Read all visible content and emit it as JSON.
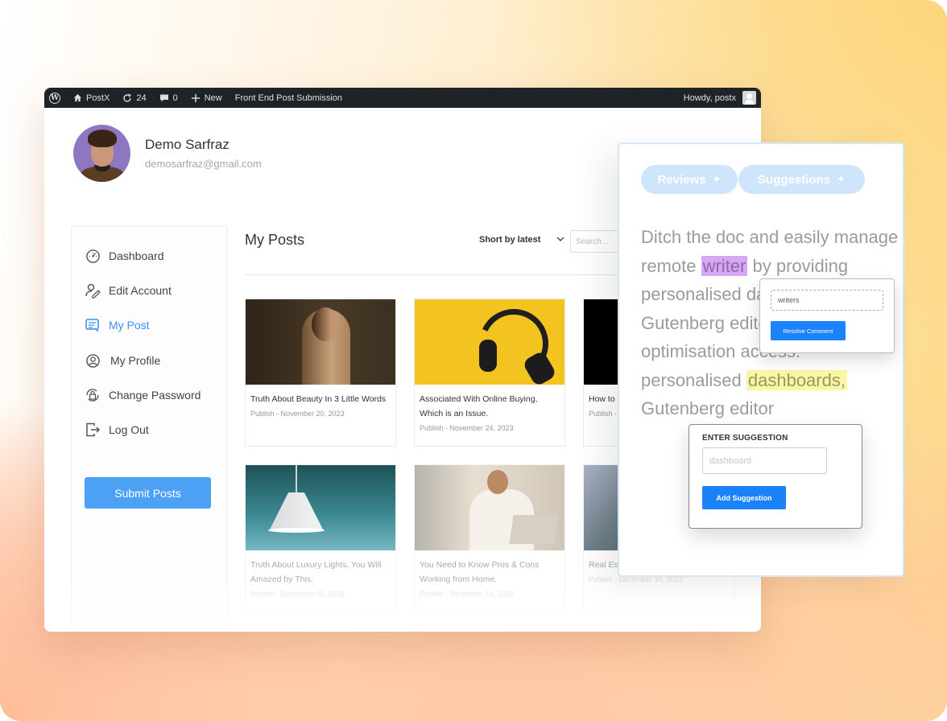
{
  "admin_bar": {
    "site_name": "PostX",
    "updates_count": "24",
    "comments_count": "0",
    "new_label": "New",
    "page_link": "Front End Post Submission",
    "greeting": "Howdy, postx"
  },
  "profile": {
    "name": "Demo Sarfraz",
    "email": "demosarfraz@gmail.com"
  },
  "sidebar": {
    "items": [
      {
        "label": "Dashboard",
        "icon": "dashboard-icon",
        "active": false
      },
      {
        "label": "Edit Account",
        "icon": "edit-user-icon",
        "active": false
      },
      {
        "label": "My Post",
        "icon": "post-list-icon",
        "active": true
      },
      {
        "label": "My Profile",
        "icon": "user-circle-icon",
        "active": false
      },
      {
        "label": "Change Password",
        "icon": "lock-refresh-icon",
        "active": false
      },
      {
        "label": "Log Out",
        "icon": "logout-icon",
        "active": false
      }
    ],
    "submit_label": "Submit Posts",
    "accent_color": "#3b8ff0"
  },
  "main": {
    "title": "My Posts",
    "sort_label": "Short by latest",
    "search_placeholder": "Search...",
    "posts": [
      {
        "title": "Truth About Beauty In 3 Little Words",
        "meta": "Publish - November 20, 2023"
      },
      {
        "title": "Associated With Online Buying, Which is an Issue.",
        "meta": "Publish - November 24, 2023"
      },
      {
        "title": "How to ... Designe...",
        "meta": "Publish - ..."
      },
      {
        "title": "Truth About Luxury Lights, You Will Amazed by This.",
        "meta": "Publish - December 02, 2023"
      },
      {
        "title": "You Need to Know Pros & Cons Working from Home.",
        "meta": "Publish - December 10, 2023"
      },
      {
        "title": "Real Est... Growing Business.",
        "meta": "Publish - December 16, 2023"
      }
    ]
  },
  "review_panel": {
    "tabs": [
      {
        "label": "Reviews",
        "icon": "sparkle-icon"
      },
      {
        "label": "Suggestions",
        "icon": "sparkle-icon"
      }
    ],
    "text_parts": {
      "p1": "Ditch the doc and easily manage remote ",
      "hl1": "writer",
      "p2": " by providing personalised dashboards, Gutenberg editor, and SEO optimisation access. personalised ",
      "hl2": "dashboards,",
      "p3": " Gutenberg editor"
    },
    "comment_popup": {
      "input_value": "writers",
      "button_label": "Resolve Comment"
    },
    "suggestion_popup": {
      "label": "ENTER SUGGESTION",
      "placeholder": "dashboard",
      "button_label": "Add Suggestion"
    },
    "colors": {
      "highlight_comment": "#d7a6f5",
      "highlight_suggestion": "#fbf6a3",
      "button": "#1a82fb"
    }
  }
}
